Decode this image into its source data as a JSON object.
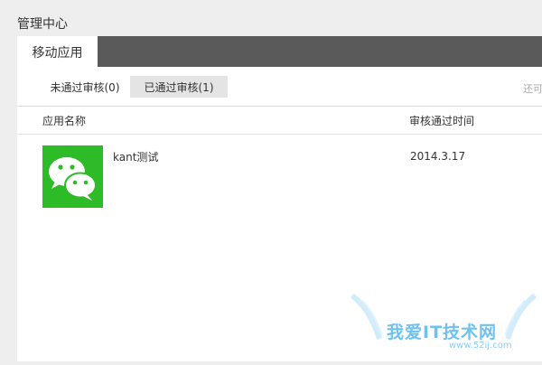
{
  "header": {
    "title": "管理中心"
  },
  "tabs": [
    {
      "label": "移动应用",
      "active": true
    }
  ],
  "filters": {
    "pending_label": "未通过审核(0)",
    "approved_label": "已通过审核(1)",
    "truncated_text": "还可"
  },
  "table": {
    "columns": [
      "应用名称",
      "审核通过时间"
    ],
    "rows": [
      {
        "icon": "wechat-icon",
        "name": "kant测试",
        "approved_time": "2014.3.17"
      }
    ]
  },
  "watermark": {
    "text": "我爱IT技术网",
    "url": "www.52ij.com"
  },
  "colors": {
    "tab_bar": "#5a5a5a",
    "icon_green": "#2dbb28",
    "page_bg": "#eeeeee",
    "watermark": "#6fc2ef"
  }
}
